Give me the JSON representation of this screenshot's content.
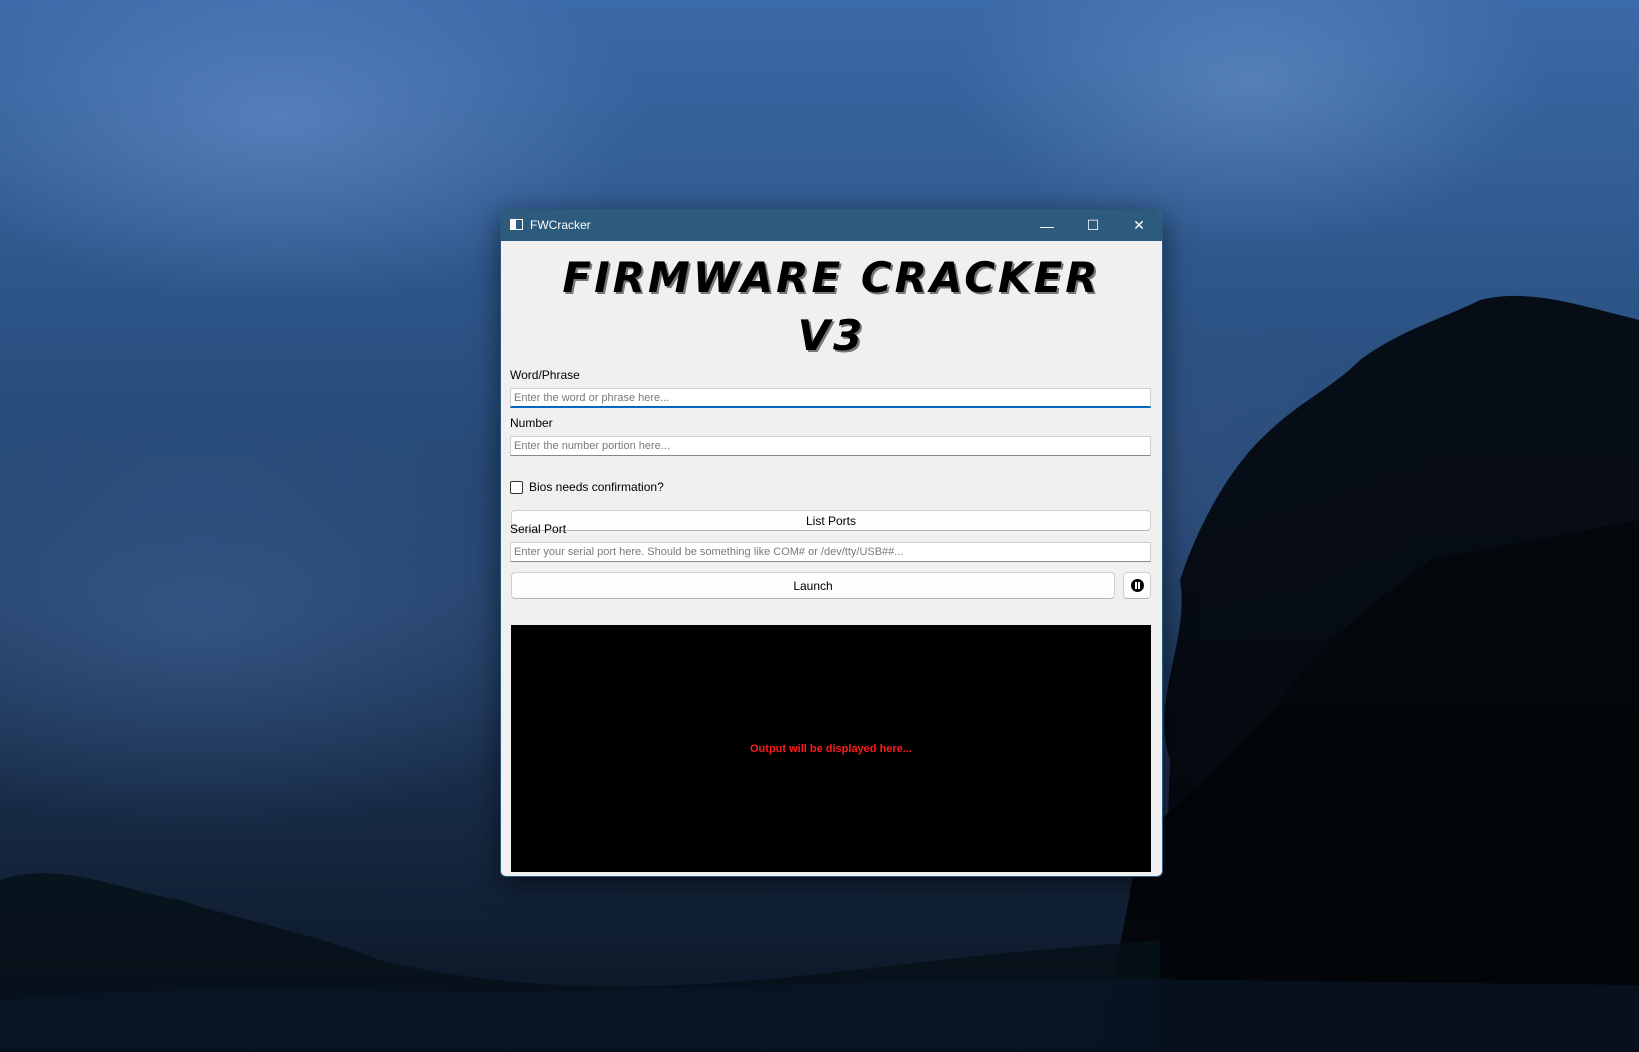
{
  "window": {
    "title": "FWCracker",
    "minimize_glyph": "—",
    "maximize_glyph": "☐",
    "close_glyph": "✕"
  },
  "heading": {
    "line1": "FIRMWARE CRACKER",
    "line2": "V3"
  },
  "word_phrase": {
    "label": "Word/Phrase",
    "placeholder": "Enter the word or phrase here...",
    "value": ""
  },
  "number": {
    "label": "Number",
    "placeholder": "Enter the number portion here...",
    "value": ""
  },
  "bios_confirmation": {
    "label": "Bios needs confirmation?",
    "checked": false
  },
  "list_ports": {
    "label": "List Ports"
  },
  "serial_port": {
    "label": "Serial Port",
    "placeholder": "Enter your serial port here. Should be something like COM# or /dev/tty/USB##...",
    "value": ""
  },
  "launch": {
    "label": "Launch"
  },
  "pause": {
    "icon": "pause-circle-icon"
  },
  "output": {
    "placeholder": "Output will be displayed here..."
  },
  "colors": {
    "titlebar": "#2d5b7e",
    "window_bg": "#f0f0f0",
    "output_bg": "#000000",
    "output_text": "#ff1a1a",
    "focus_accent": "#0067c0"
  },
  "icons": {
    "app": "app-window-icon",
    "minimize": "minimize-icon",
    "maximize": "maximize-icon",
    "close": "close-icon"
  }
}
